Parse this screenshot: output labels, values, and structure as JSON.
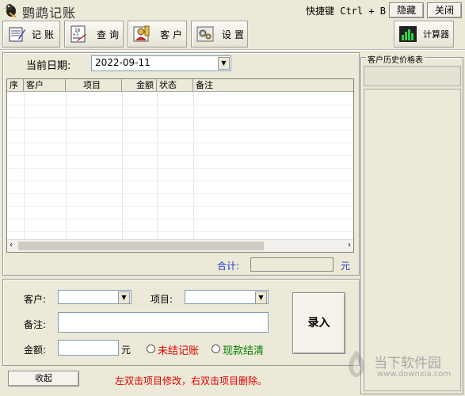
{
  "window": {
    "title": "鹦鹉记账",
    "hotkey": "快捷键 Ctrl + B",
    "hide_label": "隐藏",
    "close_label": "关闭"
  },
  "toolbar": {
    "items": [
      {
        "label": "记账",
        "icon": "ledger-icon"
      },
      {
        "label": "查询",
        "icon": "calculator-sheet-icon"
      },
      {
        "label": "客户",
        "icon": "customer-icon"
      },
      {
        "label": "设置",
        "icon": "gear-icon"
      }
    ],
    "calculator_label": "计算器"
  },
  "date": {
    "label": "当前日期:",
    "value": "2022-09-11"
  },
  "table": {
    "columns": [
      "序",
      "客户",
      "项目",
      "金额",
      "状态",
      "备注"
    ],
    "rows": []
  },
  "total": {
    "label": "合计:",
    "value": "",
    "unit": "元"
  },
  "form": {
    "customer_label": "客户:",
    "item_label": "项目:",
    "note_label": "备注:",
    "amount_label": "金额:",
    "amount_unit": "元",
    "status_unsettled": "未结记账",
    "status_cash": "现款结清",
    "submit_label": "录入"
  },
  "collapse_label": "收起",
  "hint": "左双击项目修改，右双击项目删除。",
  "history": {
    "title": "客户历史价格表"
  },
  "watermark": {
    "brand": "当下软件园",
    "url": "www.downxia.com"
  },
  "colors": {
    "background": "#ece9d8",
    "hint_red": "#e00000",
    "label_blue": "#2040c0",
    "status_green": "#008000"
  }
}
